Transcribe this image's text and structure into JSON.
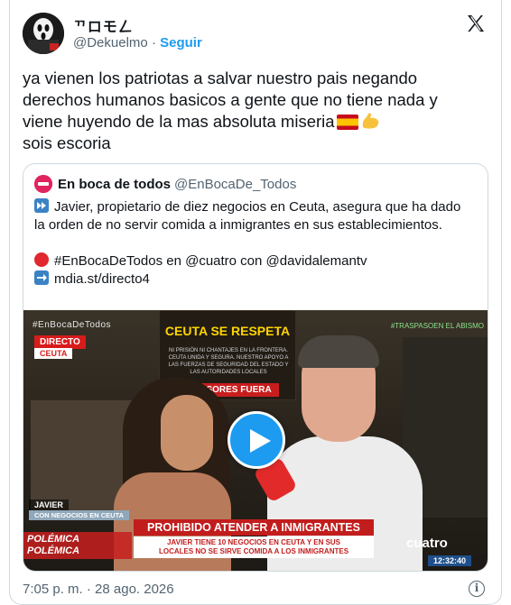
{
  "author": {
    "display_name": "ᄁロモㄥ",
    "handle": "@Dekuelmo",
    "separator": "·",
    "follow_label": "Seguir"
  },
  "tweet": {
    "lines": [
      "ya vienen los patriotas a salvar nuestro pais negando",
      "derechos humanos basicos a gente que no tiene nada y",
      "viene huyendo de la mas absoluta miseria",
      "sois escoria"
    ],
    "emojis": [
      "spain-flag-emoji",
      "flexed-biceps-emoji"
    ]
  },
  "quoted": {
    "name": "En boca de todos",
    "handle": "@EnBocaDe_Todos",
    "text_line_1": "Javier, propietario de diez negocios en Ceuta, asegura que ha dado",
    "text_line_2": "la orden de no servir comida a inmigrantes en sus establecimientos.",
    "hashtag_line": "#EnBocaDeTodos en @cuatro con @davidalemantv",
    "link": "mdia.st/directo4",
    "video": {
      "badge": "#EnBocaDeTodos",
      "badge_right": "#TRASPASOEN EL ABISMO",
      "live_label": "DIRECTO",
      "place_label": "CEUTA",
      "banner_title": "CEUTA SE RESPETA",
      "banner_text": "NI PRISIÓN NI CHANTAJES EN LA FRONTERA. CEUTA UNIDA Y SEGURA. NUESTRO APOYO A LAS FUERZAS DE SEGURIDAD DEL ESTADO Y LAS AUTORIDADES LOCALES",
      "banner_bottom": "INVASORES FUERA",
      "person_name": "JAVIER",
      "person_sub": "CON NEGOCIOS EN CEUTA",
      "polemica": "POLÉMICA POLÉMICA",
      "headline": "PROHIBIDO ATENDER A INMIGRANTES",
      "subheadline_1": "JAVIER TIENE 10 NEGOCIOS EN CEUTA Y EN SUS",
      "subheadline_2": "LOCALES NO SE SIRVE COMIDA A LOS INMIGRANTES",
      "channel": "cuatro",
      "clock": "12:32:40"
    }
  },
  "footer": {
    "timestamp": "7:05 p. m. · 28 ago. 2026",
    "info_icon": "info-icon"
  },
  "colors": {
    "accent": "#1d9bf0",
    "text": "#0f1419",
    "muted": "#536471",
    "border": "#cfd9de"
  }
}
